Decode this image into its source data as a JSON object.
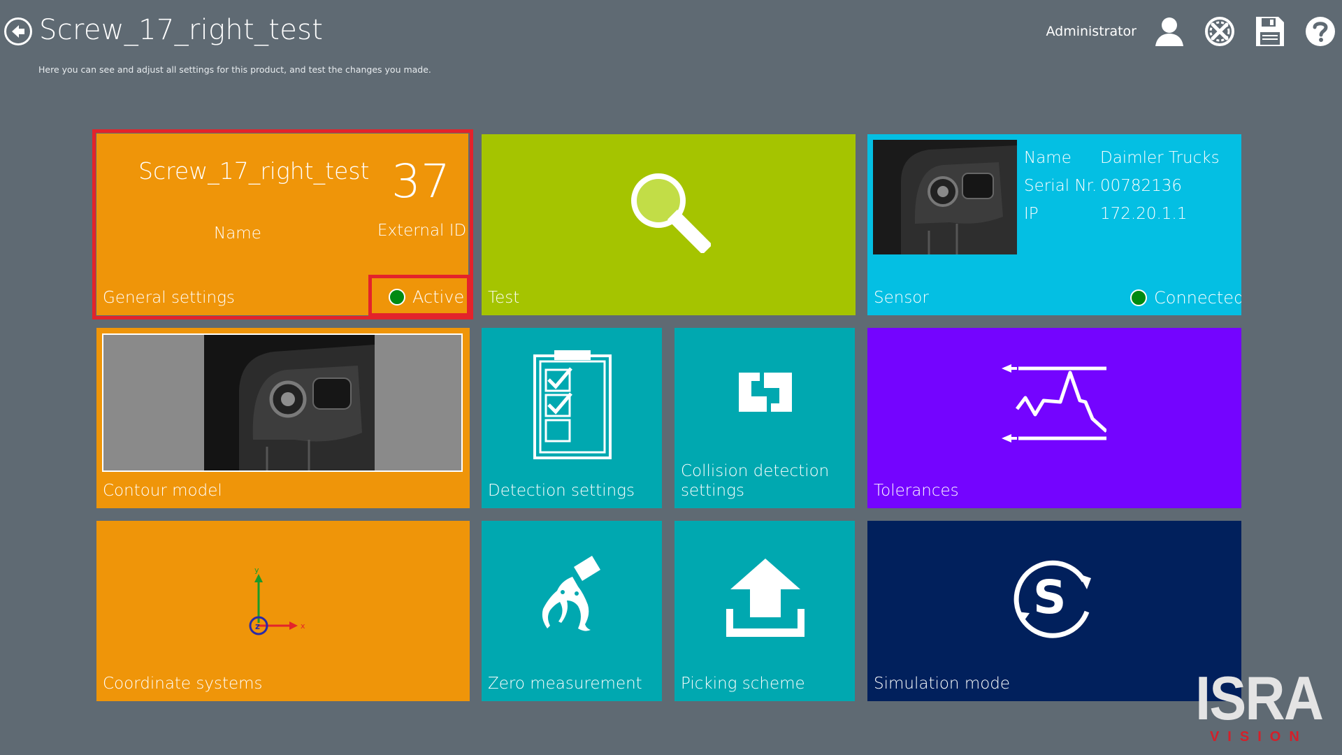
{
  "header": {
    "title": "Screw_17_right_test",
    "subtitle": "Here you can see and adjust all settings for this product, and test the changes you made.",
    "user": "Administrator",
    "icons": [
      "back-arrow-icon",
      "user-icon",
      "tools-icon",
      "save-icon",
      "help-icon"
    ]
  },
  "general_settings": {
    "product_name": "Screw_17_right_test",
    "name_caption": "Name",
    "external_id": "37",
    "external_id_caption": "External ID",
    "status": "Active",
    "label": "General settings"
  },
  "test": {
    "label": "Test"
  },
  "sensor": {
    "label": "Sensor",
    "fields": [
      {
        "key": "Name",
        "value": "Daimler Trucks"
      },
      {
        "key": "Serial Nr.",
        "value": "00782136"
      },
      {
        "key": "IP",
        "value": "172.20.1.1"
      }
    ],
    "status": "Connected"
  },
  "tiles": {
    "contour_model": "Contour model",
    "detection_settings": "Detection settings",
    "collision_detection_line1": "Collision detection",
    "collision_detection_line2": "settings",
    "tolerances": "Tolerances",
    "coordinate_systems": "Coordinate systems",
    "zero_measurement": "Zero measurement",
    "picking_scheme": "Picking scheme",
    "simulation_mode": "Simulation mode"
  },
  "brand": {
    "main": "ISRA",
    "sub": "VISION"
  },
  "colors": {
    "background": "#5f6a73",
    "orange": "#ef9509",
    "lime": "#a5c400",
    "cyan": "#04bfe3",
    "teal": "#00a8b0",
    "purple": "#7404ff",
    "navy": "#01205c",
    "highlight": "#e3232b",
    "status_green": "#008a12"
  }
}
